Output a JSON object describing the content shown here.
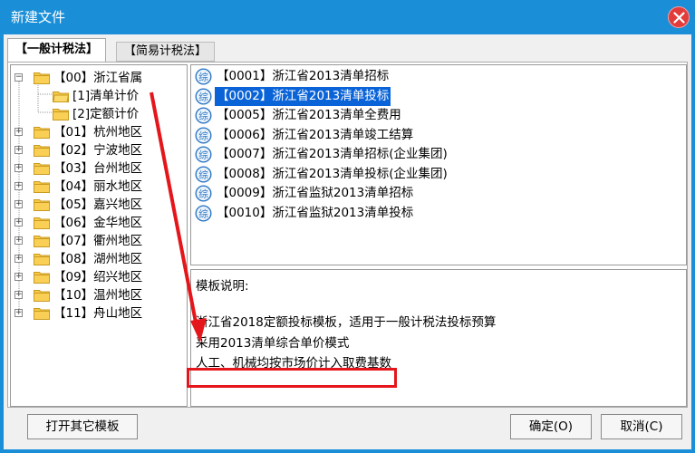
{
  "window": {
    "title": "新建文件"
  },
  "tabs": [
    {
      "label": "【一般计税法】"
    },
    {
      "label": "【简易计税法】"
    }
  ],
  "tree": {
    "items": [
      {
        "label": "【00】浙江省属",
        "expander": "−"
      },
      {
        "label": "[1]清单计价"
      },
      {
        "label": "[2]定额计价"
      },
      {
        "label": "【01】杭州地区",
        "expander": "+"
      },
      {
        "label": "【02】宁波地区",
        "expander": "+"
      },
      {
        "label": "【03】台州地区",
        "expander": "+"
      },
      {
        "label": "【04】丽水地区",
        "expander": "+"
      },
      {
        "label": "【05】嘉兴地区",
        "expander": "+"
      },
      {
        "label": "【06】金华地区",
        "expander": "+"
      },
      {
        "label": "【07】衢州地区",
        "expander": "+"
      },
      {
        "label": "【08】湖州地区",
        "expander": "+"
      },
      {
        "label": "【09】绍兴地区",
        "expander": "+"
      },
      {
        "label": "【10】温州地区",
        "expander": "+"
      },
      {
        "label": "【11】舟山地区",
        "expander": "+"
      }
    ]
  },
  "templates": {
    "icon_glyph": "综",
    "items": [
      {
        "label": "【0001】浙江省2013清单招标"
      },
      {
        "label": "【0002】浙江省2013清单投标"
      },
      {
        "label": "【0005】浙江省2013清单全费用"
      },
      {
        "label": "【0006】浙江省2013清单竣工结算"
      },
      {
        "label": "【0007】浙江省2013清单招标(企业集团)"
      },
      {
        "label": "【0008】浙江省2013清单投标(企业集团)"
      },
      {
        "label": "【0009】浙江省监狱2013清单招标"
      },
      {
        "label": "【0010】浙江省监狱2013清单投标"
      }
    ]
  },
  "description": {
    "heading": "模板说明:",
    "lines": [
      "浙江省2018定额投标模板，适用于一般计税法投标预算",
      "采用2013清单综合单价模式",
      "人工、机械均按市场价计入取费基数"
    ]
  },
  "buttons": {
    "open_other": "打开其它模板",
    "ok": "确定(O)",
    "cancel": "取消(C)"
  },
  "colors": {
    "titlebar": "#1a8fd8",
    "selection": "#0a64d8",
    "annotation_red": "#e4161b",
    "folder": "#f7c948"
  }
}
